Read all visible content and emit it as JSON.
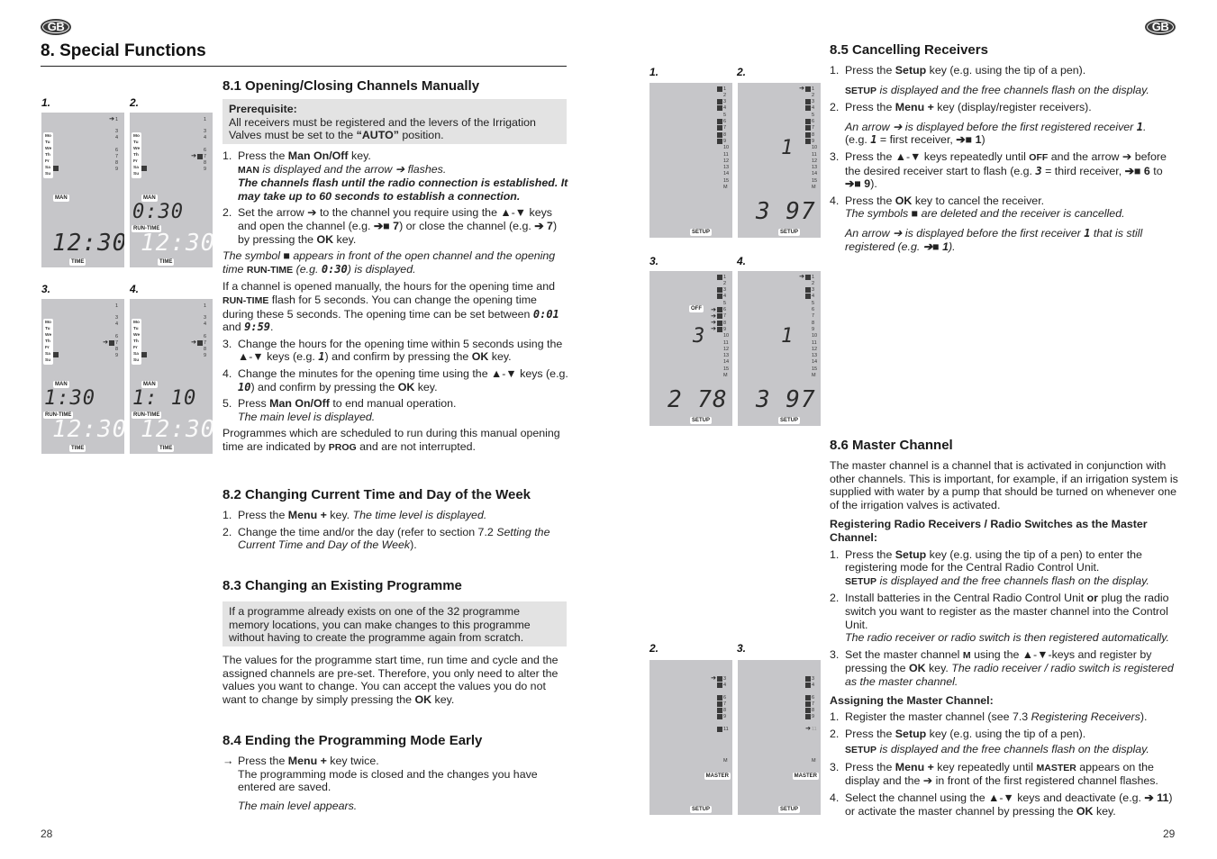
{
  "left_page": {
    "badge": "GB",
    "chapter_title": "8. Special Functions",
    "page_number": "28",
    "figures": [
      {
        "label": "1.",
        "tags": {
          "man": "MAN",
          "time": "TIME"
        },
        "runtime": "",
        "time": "12:30"
      },
      {
        "label": "2.",
        "tags": {
          "man": "MAN",
          "runtime": "RUN-TIME",
          "time": "TIME"
        },
        "runtime": "0:30",
        "time": "12:30"
      },
      {
        "label": "3.",
        "tags": {
          "man": "MAN",
          "runtime": "RUN-TIME",
          "time": "TIME"
        },
        "runtime": "1:30",
        "time": "12:30"
      },
      {
        "label": "4.",
        "tags": {
          "man": "MAN",
          "runtime": "RUN-TIME",
          "time": "TIME"
        },
        "runtime": "1: 10",
        "time": "12:30"
      }
    ],
    "lcd_days": [
      "Mo",
      "Tu",
      "We",
      "Th",
      "Fr",
      "Sa",
      "Su"
    ],
    "lcd_channels": [
      "1",
      "3",
      "4",
      "6",
      "7",
      "8",
      "9"
    ],
    "s81": {
      "title": "8.1  Opening/Closing Channels Manually",
      "prereq_title": "Prerequisite:",
      "prereq_text_1": "All receivers must be registered and the levers of the Irrigation Valves must be set to the ",
      "prereq_bold": "“AUTO”",
      "prereq_text_2": " position.",
      "step1_a": "Press the ",
      "step1_b": "Man On/Off",
      "step1_c": " key.",
      "step1_d_sc": "MAN",
      "step1_d": " is displayed and the arrow ➔ flashes.",
      "step1_e": "The channels flash until the radio connection is established. It may take up to 60 seconds to establish a connection.",
      "step2_a": "Set the arrow ➔ to the channel you require using the ▲-▼ keys and open the channel (e.g. ",
      "step2_b": "➔■ 7",
      "step2_c": ") or close the channel (e.g. ",
      "step2_d": "➔ 7",
      "step2_e": ") by pressing the ",
      "step2_f": "OK",
      "step2_g": " key.",
      "sym_a": "The symbol ■ appears in front of the open channel and the opening time ",
      "sym_sc": "RUN-TIME",
      "sym_b": " (e.g. ",
      "sym_seg": "0:30",
      "sym_c": ") is displayed.",
      "para_a": "If a channel is opened manually, the hours for the opening time and ",
      "para_sc": "RUN-TIME",
      "para_b": " flash for 5 seconds. You can change the opening time during these 5 seconds. The opening time can be set between ",
      "para_seg1": "0:01",
      "para_c": " and ",
      "para_seg2": "9:59",
      "para_d": ".",
      "step3_a": "Change the hours for the opening time within 5 seconds using the ▲-▼ keys (e.g. ",
      "step3_seg": "1",
      "step3_b": ") and confirm by pressing the ",
      "step3_c": "OK",
      "step3_d": " key.",
      "step4_a": "Change the minutes for the opening time using the ▲-▼ keys (e.g. ",
      "step4_seg": "10",
      "step4_b": ") and confirm by pressing the ",
      "step4_c": "OK",
      "step4_d": " key.",
      "step5_a": "Press ",
      "step5_b": "Man On/Off",
      "step5_c": " to end manual operation.",
      "step5_d": "The main level is displayed.",
      "prog_a": "Programmes which are scheduled to run during this manual opening time are indicated by ",
      "prog_sc": "PROG",
      "prog_b": " and are not interrupted."
    },
    "s82": {
      "title": "8.2  Changing Current Time and Day of the Week",
      "step1_a": "Press the ",
      "step1_b": "Menu +",
      "step1_c": " key. ",
      "step1_d": "The time level is displayed.",
      "step2_a": "Change the time and/or the day (refer to section 7.2 ",
      "step2_b": "Setting the Current Time and Day of the Week",
      "step2_c": ")."
    },
    "s83": {
      "title": "8.3  Changing an Existing Programme",
      "box": "If a programme already exists on one of the 32 programme memory locations, you can make changes to this programme without having to create the programme again from scratch.",
      "para_a": "The values for the programme start time, run time and cycle and the assigned channels are pre-set. Therefore, you only need to alter the values you want to change. You can accept the values you do not want to change by simply pressing the ",
      "para_b": "OK",
      "para_c": " key."
    },
    "s84": {
      "title": "8.4  Ending the Programming Mode Early",
      "arrow": "→",
      "step_a": "Press the ",
      "step_b": "Menu +",
      "step_c": " key twice.",
      "step_d": "The programming mode is closed and the changes you have entered are saved.",
      "step_e": "The main level appears."
    }
  },
  "right_page": {
    "badge": "GB",
    "page_number": "29",
    "figures_cancel": [
      {
        "label": "1.",
        "setup": "SETUP",
        "top_digit": "",
        "bottom_digits": ""
      },
      {
        "label": "2.",
        "setup": "SETUP",
        "top_digit": "1",
        "bottom_digits": "3 97"
      },
      {
        "label": "3.",
        "setup": "SETUP",
        "off": "OFF",
        "top_digit": "3",
        "bottom_digits": "2 78"
      },
      {
        "label": "4.",
        "setup": "SETUP",
        "top_digit": "1",
        "bottom_digits": "3 97"
      }
    ],
    "figures_master": [
      {
        "label": "2.",
        "master": "MASTER",
        "setup": "SETUP"
      },
      {
        "label": "3.",
        "master": "MASTER",
        "setup": "SETUP"
      }
    ],
    "channels_all": [
      "1",
      "2",
      "3",
      "4",
      "5",
      "6",
      "7",
      "8",
      "9",
      "10",
      "11",
      "12",
      "13",
      "14",
      "15",
      "M"
    ],
    "s85": {
      "title": "8.5  Cancelling Receivers",
      "step1_a": "Press the ",
      "step1_b": "Setup",
      "step1_c": " key (e.g. using the tip of a pen).",
      "step1_sc": "SETUP",
      "step1_d": " is displayed and the free channels flash on the display.",
      "step2_a": "Press the ",
      "step2_b": "Menu +",
      "step2_c": " key (display/register receivers).",
      "step2_d": "An arrow ➔ is displayed before the first registered receiver ",
      "step2_seg": "1",
      "step2_e": ".",
      "step2_f": "(e.g. ",
      "step2_seg2": "1",
      "step2_g": " = first receiver, ",
      "step2_h": "➔■ 1",
      "step2_i": ")",
      "step3_a": "Press the ▲-▼ keys repeatedly until ",
      "step3_sc": "OFF",
      "step3_b": " and the arrow ➔ before the desired receiver start to flash (e.g. ",
      "step3_seg": "3",
      "step3_c": " = third receiver, ",
      "step3_d": "➔■ 6",
      "step3_e": " to ",
      "step3_f": "➔■ 9",
      "step3_g": ").",
      "step4_a": "Press the ",
      "step4_b": "OK",
      "step4_c": " key to cancel the receiver.",
      "step4_d": "The symbols ■ are deleted and the receiver is cancelled.",
      "step4_e": "An arrow ➔ is displayed before the first receiver ",
      "step4_seg": "1",
      "step4_f": " that is still registered (e.g. ",
      "step4_g": "➔■ 1",
      "step4_h": ")."
    },
    "s86": {
      "title": "8.6  Master Channel",
      "intro": "The master channel is a channel that is activated in conjunction with other channels. This is important, for example, if an irrigation system is supplied with water by a pump that should be turned on whenever one of the irrigation valves is activated.",
      "reg_title": "Registering Radio Receivers / Radio Switches as the Master Channel:",
      "r1_a": "Press the ",
      "r1_b": "Setup",
      "r1_c": " key (e.g. using the tip of a pen) to enter the registering mode for the Central Radio Control Unit.",
      "r1_sc": "SETUP",
      "r1_d": " is displayed and the free channels flash on the display.",
      "r2_a": "Install batteries in the Central Radio Control Unit ",
      "r2_b": "or",
      "r2_c": " plug the radio switch you want to register as the master channel into the Control Unit.",
      "r2_d": "The radio receiver or radio switch is then registered automatically.",
      "r3_a": "Set the master channel ",
      "r3_sc": "M",
      "r3_b": " using the ▲-▼-keys and register by pressing the ",
      "r3_c": "OK",
      "r3_d": " key. ",
      "r3_e": "The radio receiver / radio switch is registered as the master channel.",
      "assign_title": "Assigning the Master Channel:",
      "a1_a": "Register the master channel (see 7.3 ",
      "a1_b": "Registering Receivers",
      "a1_c": ").",
      "a2_a": "Press the ",
      "a2_b": "Setup",
      "a2_c": " key (e.g. using the tip of a pen).",
      "a2_sc": "SETUP",
      "a2_d": " is displayed and the free channels flash on the display.",
      "a3_a": "Press the ",
      "a3_b": "Menu +",
      "a3_c": " key repeatedly until ",
      "a3_sc": "MASTER",
      "a3_d": " appears on the display and the ➔ in front of the first registered channel flashes.",
      "a4_a": "Select the channel using the ▲-▼ keys and deactivate (e.g. ",
      "a4_b": "➔ 11",
      "a4_c": ") or activate the master channel by pressing the ",
      "a4_d": "OK",
      "a4_e": " key."
    }
  }
}
